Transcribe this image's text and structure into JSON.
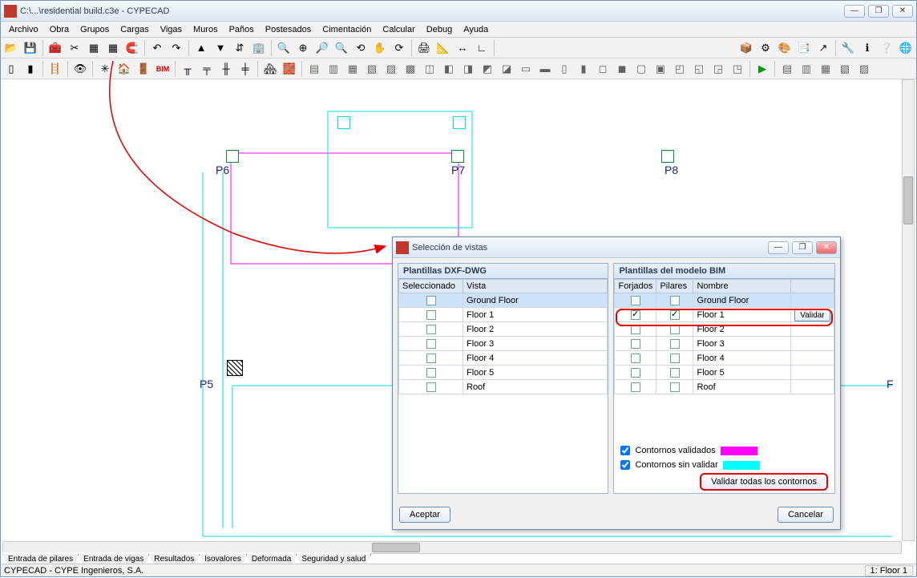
{
  "window": {
    "title": "C:\\...\\residential build.c3e - CYPECAD",
    "min": "—",
    "max": "❐",
    "close": "✕"
  },
  "menu": {
    "archivo": "Archivo",
    "obra": "Obra",
    "grupos": "Grupos",
    "cargas": "Cargas",
    "vigas": "Vigas",
    "muros": "Muros",
    "panos": "Paños",
    "postesados": "Postesados",
    "cimentacion": "Cimentación",
    "calcular": "Calcular",
    "debug": "Debug",
    "ayuda": "Ayuda"
  },
  "columns": {
    "p6": "P6",
    "p7": "P7",
    "p8": "P8",
    "p5": "P5"
  },
  "bottom_tabs": {
    "t1": "Entrada de pilares",
    "t2": "Entrada de vigas",
    "t3": "Resultados",
    "t4": "Isovalores",
    "t5": "Deformada",
    "t6": "Seguridad y salud"
  },
  "status": {
    "left": "CYPECAD - CYPE Ingenieros, S.A.",
    "right": "1: Floor 1"
  },
  "dialog": {
    "title": "Selección de vistas",
    "left_header": "Plantillas DXF-DWG",
    "right_header": "Plantillas del modelo BIM",
    "col_seleccionado": "Seleccionado",
    "col_vista": "Vista",
    "col_forjados": "Forjados",
    "col_pilares": "Pilares",
    "col_nombre": "Nombre",
    "rows": {
      "r0": "Ground Floor",
      "r1": "Floor 1",
      "r2": "Floor 2",
      "r3": "Floor 3",
      "r4": "Floor 4",
      "r5": "Floor 5",
      "r6": "Roof"
    },
    "validar": "Validar",
    "legend_validados": "Contornos validados",
    "legend_sin_validar": "Contornos sin validar",
    "validar_todas": "Validar todas los contornos",
    "aceptar": "Aceptar",
    "cancelar": "Cancelar",
    "colors": {
      "validados": "#ff00ff",
      "sin_validar": "#00ffff"
    }
  }
}
